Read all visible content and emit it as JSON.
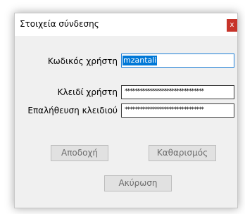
{
  "window": {
    "title": "Στοιχεία σύνδεσης",
    "close_glyph": "x"
  },
  "form": {
    "username_label": "Κωδικός χρήστη",
    "username_value": "mzantali",
    "password_label": "Κλειδί χρήστη",
    "password_value": "********************************",
    "confirm_label": "Επαλήθευση κλειδιού",
    "confirm_value": "********************************"
  },
  "buttons": {
    "accept": "Αποδοχή",
    "clear": "Καθαρισμός",
    "cancel": "Ακύρωση"
  },
  "colors": {
    "close_button": "#c7342a",
    "selection": "#0078d7",
    "focus_border": "#1e7fd8"
  }
}
